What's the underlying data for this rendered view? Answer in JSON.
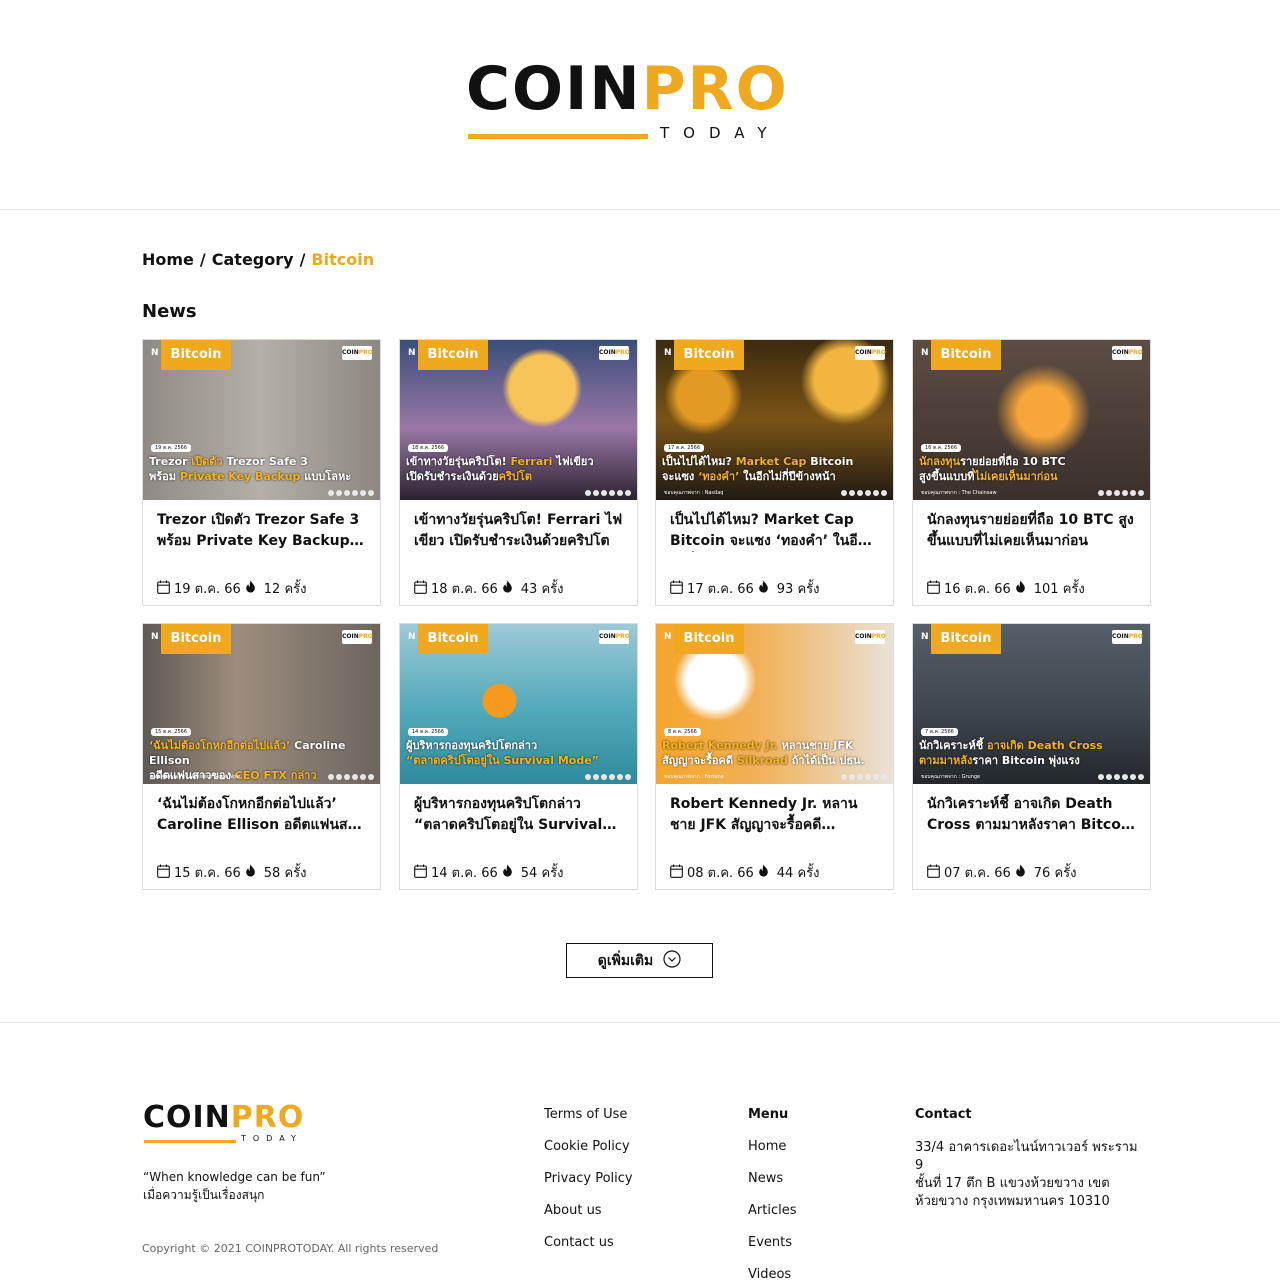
{
  "header": {
    "logo_coin": "COIN",
    "logo_pro": "PRO",
    "logo_today": "TODAY"
  },
  "breadcrumb": {
    "home": "Home",
    "category": "Category",
    "current": "Bitcoin",
    "separator": "/"
  },
  "section_title": "News",
  "colors": {
    "accent": "#f0a81e",
    "text": "#111111",
    "border": "#dcdcdc"
  },
  "cards": [
    {
      "tag": "Bitcoin",
      "title": "Trezor เปิดตัว Trezor Safe 3 พร้อม Private Key Backup แบบโลหะ",
      "date": "19 ต.ค. 66",
      "views": "12 ครั้ง",
      "thumb_date": "19 ต.ค. 2566",
      "thumb_line1_a": "Trezor",
      "thumb_line1_b": " เปิดตัว ",
      "thumb_line1_c": "Trezor Safe 3",
      "thumb_line2_a": "พร้อม ",
      "thumb_line2_b": "Private Key Backup",
      "thumb_line2_c": " แบบโลหะ",
      "thumb_credit": ""
    },
    {
      "tag": "Bitcoin",
      "title": "เข้าทางวัยรุ่นคริปโต! Ferrari ไฟเขียว เปิดรับชำระเงินด้วยคริปโต",
      "date": "18 ต.ค. 66",
      "views": "43 ครั้ง",
      "thumb_date": "18 ต.ค. 2566",
      "thumb_line1_a": "เข้าทางวัยรุ่นคริปโต! ",
      "thumb_line1_b": "Ferrari",
      "thumb_line1_c": " ไฟเขียว",
      "thumb_line2_a": "เปิดรับชำระเงินด้วย",
      "thumb_line2_b": "คริปโต",
      "thumb_line2_c": "",
      "thumb_credit": ""
    },
    {
      "tag": "Bitcoin",
      "title": "เป็นไปได้ไหม? Market Cap Bitcoin จะแซง ‘ทองคำ’ ในอีกไม่กี่ปีข้างหน้า",
      "date": "17 ต.ค. 66",
      "views": "93 ครั้ง",
      "thumb_date": "17 ต.ค. 2566",
      "thumb_line1_a": "เป็นไปได้ไหม? ",
      "thumb_line1_b": "Market Cap",
      "thumb_line1_c": " Bitcoin",
      "thumb_line2_a": "จะแซง ",
      "thumb_line2_b": "‘ทองคำ’",
      "thumb_line2_c": " ในอีกไม่กี่ปีข้างหน้า",
      "thumb_credit": "ขอบคุณภาพจาก : Nasdaq"
    },
    {
      "tag": "Bitcoin",
      "title": "นักลงทุนรายย่อยที่ถือ 10 BTC สูงขึ้นแบบที่ไม่เคยเห็นมาก่อน",
      "date": "16 ต.ค. 66",
      "views": "101 ครั้ง",
      "thumb_date": "16 ต.ค. 2566",
      "thumb_line1_a": "",
      "thumb_line1_b": "นักลงทุน",
      "thumb_line1_c": "รายย่อยที่ถือ 10 BTC",
      "thumb_line2_a": "สูงขึ้นแบบที่",
      "thumb_line2_b": "ไม่เคยเห็นมาก่อน",
      "thumb_line2_c": "",
      "thumb_credit": "ขอบคุณภาพจาก : The Chainsaw"
    },
    {
      "tag": "Bitcoin",
      "title": "‘ฉันไม่ต้องโกหกอีกต่อไปแล้ว’ Caroline Ellison อดีตแฟนสาวของ CEO FTX กล่าว",
      "date": "15 ต.ค. 66",
      "views": "58 ครั้ง",
      "thumb_date": "15 ต.ค. 2566",
      "thumb_line1_a": "",
      "thumb_line1_b": "‘ฉันไม่ต้องโกหกอีกต่อไปแล้ว’",
      "thumb_line1_c": " Caroline Ellison",
      "thumb_line2_a": "อดีตแฟนสาวของ ",
      "thumb_line2_b": "CEO FTX กล่าว",
      "thumb_line2_c": "",
      "thumb_credit": "ขอบคุณภาพจาก : Western Slope Now"
    },
    {
      "tag": "Bitcoin",
      "title": "ผู้บริหารกองทุนคริปโตกล่าว “ตลาดคริปโตอยู่ใน Survival Mode”",
      "date": "14 ต.ค. 66",
      "views": "54 ครั้ง",
      "thumb_date": "14 ต.ค. 2566",
      "thumb_line1_a": "ผู้บริหารกองทุนคริปโตกล่าว",
      "thumb_line1_b": "",
      "thumb_line1_c": "",
      "thumb_line2_a": "",
      "thumb_line2_b": "“ตลาดคริปโตอยู่ใน Survival Mode”",
      "thumb_line2_c": "",
      "thumb_credit": ""
    },
    {
      "tag": "Bitcoin",
      "title": "Robert Kennedy Jr. หลานชาย JFK สัญญาจะรื้อคดี Silkroad ถ้าได้เป็น ปธน.",
      "date": "08 ต.ค. 66",
      "views": "44 ครั้ง",
      "thumb_date": "8 ต.ค. 2566",
      "thumb_line1_a": "",
      "thumb_line1_b": "Robert Kennedy Jr.",
      "thumb_line1_c": " หลานชาย JFK",
      "thumb_line2_a": "สัญญาจะรื้อคดี ",
      "thumb_line2_b": "Silkroad",
      "thumb_line2_c": " ถ้าได้เป็น ปธน.",
      "thumb_credit": "ขอบคุณภาพจาก : Fortune"
    },
    {
      "tag": "Bitcoin",
      "title": "นักวิเคราะห์ชี้ อาจเกิด Death Cross ตามมาหลังราคา Bitcoin พุ่งแรง",
      "date": "07 ต.ค. 66",
      "views": "76 ครั้ง",
      "thumb_date": "7 ต.ค. 2566",
      "thumb_line1_a": "นักวิเคราะห์ชี้ ",
      "thumb_line1_b": "อาจเกิด Death Cross",
      "thumb_line1_c": "",
      "thumb_line2_a": "",
      "thumb_line2_b": "ตามมาหลัง",
      "thumb_line2_c": "ราคา Bitcoin พุ่งแรง",
      "thumb_credit": "ขอบคุณภาพจาก : Grunge"
    }
  ],
  "more_button": "ดูเพิ่มเติม",
  "footer": {
    "logo_coin": "COIN",
    "logo_pro": "PRO",
    "logo_today": "TODAY",
    "tagline_1": "“When knowledge can be fun”",
    "tagline_2": "เมื่อความรู้เป็นเรื่องสนุก",
    "copyright": "Copyright © 2021 COINPROTODAY. All rights reserved",
    "links": [
      "Terms of Use",
      "Cookie Policy",
      "Privacy Policy",
      "About us",
      "Contact us"
    ],
    "menu_head": "Menu",
    "menu": [
      "Home",
      "News",
      "Articles",
      "Events",
      "Videos"
    ],
    "contact_head": "Contact",
    "contact_lines": [
      "33/4 อาคารเดอะไนน์ทาวเวอร์ พระราม 9",
      "ชั้นที่ 17 ตึก B แขวงห้วยขวาง เขต",
      "ห้วยขวาง กรุงเทพมหานคร 10310"
    ]
  }
}
